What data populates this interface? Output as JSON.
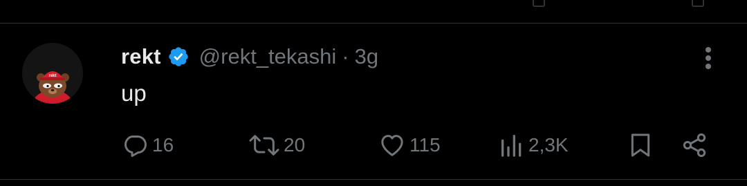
{
  "tweet": {
    "author": {
      "name": "rekt",
      "handle": "@rekt_tekashi",
      "verified": true,
      "avatar_icon": "rekt-bear-avatar-icon"
    },
    "separator": "·",
    "time": "3g",
    "text": "up",
    "actions": {
      "reply": {
        "icon": "reply-icon",
        "count": "16"
      },
      "retweet": {
        "icon": "retweet-icon",
        "count": "20"
      },
      "like": {
        "icon": "heart-icon",
        "count": "115"
      },
      "views": {
        "icon": "views-icon",
        "count": "2,3K"
      },
      "bookmark": {
        "icon": "bookmark-icon"
      },
      "share": {
        "icon": "share-icon"
      }
    }
  },
  "colors": {
    "background": "#000000",
    "primary_text": "#e7e9ea",
    "secondary_text": "#71767b",
    "verified_blue": "#1d9bf0",
    "divider": "#2f3336"
  }
}
